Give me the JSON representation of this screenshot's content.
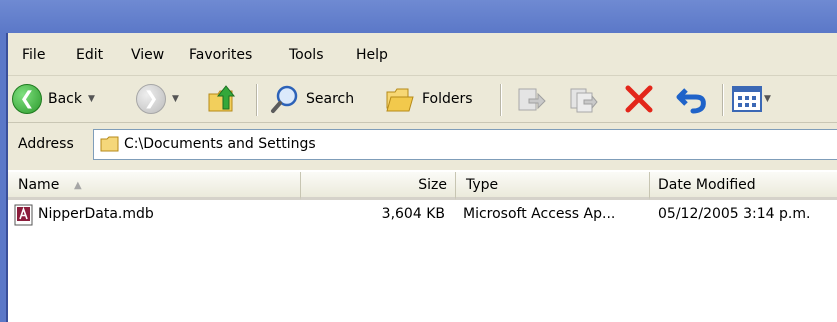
{
  "menu": [
    "File",
    "Edit",
    "View",
    "Favorites",
    "Tools",
    "Help"
  ],
  "toolbar": {
    "back_label": "Back",
    "search_label": "Search",
    "folders_label": "Folders"
  },
  "address": {
    "label": "Address",
    "path": "C:\\Documents and Settings"
  },
  "columns": {
    "name": "Name",
    "size": "Size",
    "type": "Type",
    "date": "Date Modified"
  },
  "files": [
    {
      "name": "NipperData.mdb",
      "size": "3,604 KB",
      "type": "Microsoft Access Ap...",
      "date": "05/12/2005 3:14 p.m."
    }
  ],
  "colors": {
    "title_blue": "#5b78c8",
    "chrome": "#ece9d8",
    "delete_red": "#e3261a",
    "undo_blue": "#1f63c9"
  }
}
